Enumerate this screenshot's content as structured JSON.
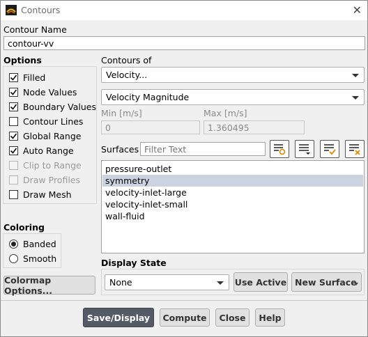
{
  "window": {
    "title": "Contours"
  },
  "contour_name": {
    "label": "Contour Name",
    "value": "contour-vv"
  },
  "options": {
    "heading": "Options",
    "items": [
      {
        "label": "Filled",
        "checked": true,
        "enabled": true
      },
      {
        "label": "Node Values",
        "checked": true,
        "enabled": true
      },
      {
        "label": "Boundary Values",
        "checked": true,
        "enabled": true
      },
      {
        "label": "Contour Lines",
        "checked": false,
        "enabled": true
      },
      {
        "label": "Global Range",
        "checked": true,
        "enabled": true
      },
      {
        "label": "Auto Range",
        "checked": true,
        "enabled": true
      },
      {
        "label": "Clip to Range",
        "checked": false,
        "enabled": false
      },
      {
        "label": "Draw Profiles",
        "checked": false,
        "enabled": false
      },
      {
        "label": "Draw Mesh",
        "checked": false,
        "enabled": true
      }
    ]
  },
  "contours_of": {
    "label": "Contours of",
    "primary": "Velocity...",
    "secondary": "Velocity Magnitude"
  },
  "range": {
    "min_label": "Min [m/s]",
    "min_value": "0",
    "max_label": "Max [m/s]",
    "max_value": "1.360495"
  },
  "surfaces": {
    "label": "Surfaces",
    "filter_placeholder": "Filter Text",
    "items": [
      "pressure-outlet",
      "symmetry",
      "velocity-inlet-large",
      "velocity-inlet-small",
      "wall-fluid"
    ],
    "selected": "symmetry"
  },
  "coloring": {
    "heading": "Coloring",
    "options": [
      "Banded",
      "Smooth"
    ],
    "selected": "Banded"
  },
  "colormap_button": "Colormap Options...",
  "display_state": {
    "label": "Display State",
    "value": "None",
    "use_active": "Use Active",
    "new_surface": "New Surface"
  },
  "footer": {
    "save_display": "Save/Display",
    "compute": "Compute",
    "close": "Close",
    "help": "Help"
  }
}
